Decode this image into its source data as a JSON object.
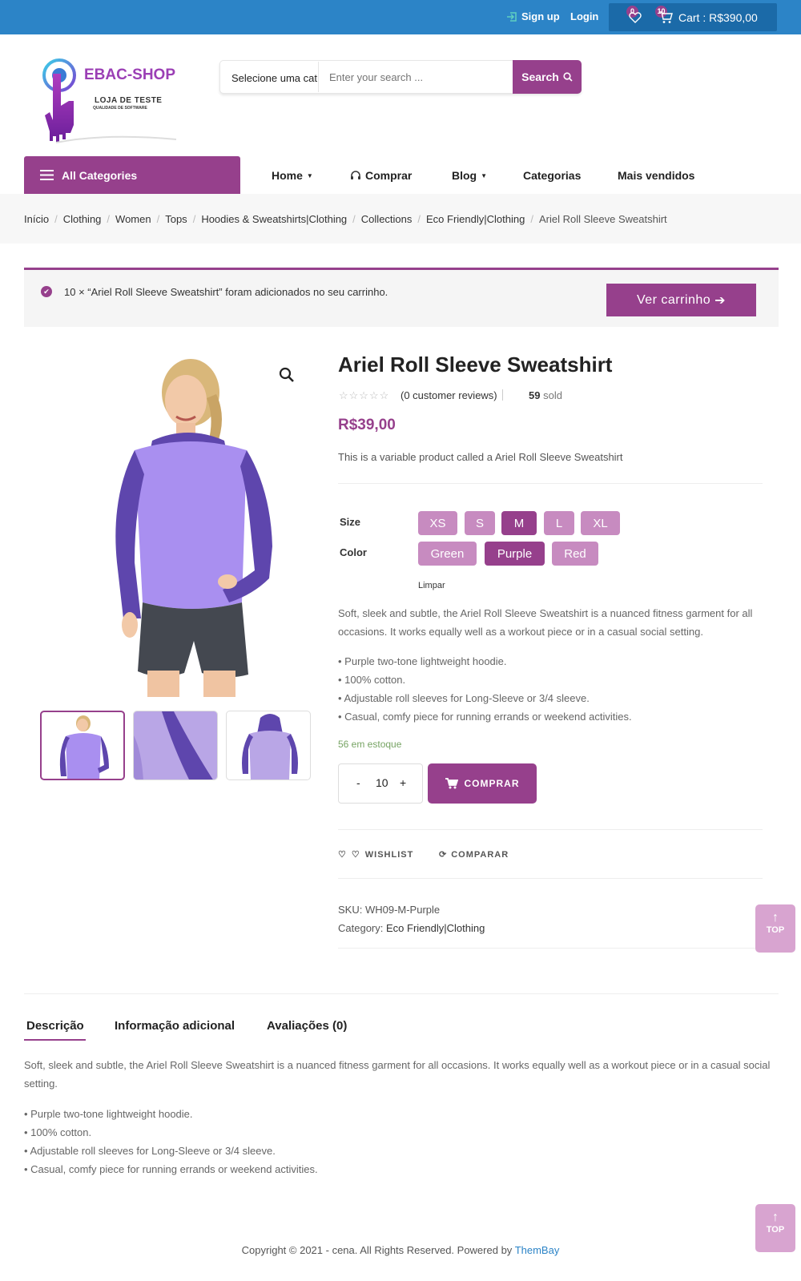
{
  "topbar": {
    "signup": "Sign up",
    "login": "Login",
    "wishlist_count": "0",
    "cart_count": "10",
    "cart_label": "Cart : R$390,00"
  },
  "logo": {
    "brand": "EBAC-SHOP",
    "line1": "LOJA DE TESTE",
    "line2": "QUALIDADE DE SOFTWARE"
  },
  "search": {
    "category": "Selecione uma cat",
    "placeholder": "Enter your search ...",
    "button": "Search"
  },
  "nav": {
    "all_categories": "All Categories",
    "items": [
      "Home",
      "Comprar",
      "Blog",
      "Categorias",
      "Mais vendidos"
    ]
  },
  "breadcrumb": [
    "Início",
    "Clothing",
    "Women",
    "Tops",
    "Hoodies & Sweatshirts|Clothing",
    "Collections",
    "Eco Friendly|Clothing",
    "Ariel Roll Sleeve Sweatshirt"
  ],
  "notice": {
    "message": "10 × “Ariel Roll Sleeve Sweatshirt” foram adicionados no seu carrinho.",
    "button": "Ver carrinho"
  },
  "product": {
    "title": "Ariel Roll Sleeve Sweatshirt",
    "rating": 0,
    "reviews": "(0 customer reviews)",
    "sold_count": "59",
    "sold_label": "sold",
    "price": "R$39,00",
    "short_desc": "This is a variable product called a Ariel Roll Sleeve Sweatshirt",
    "size_label": "Size",
    "sizes": [
      "XS",
      "S",
      "M",
      "L",
      "XL"
    ],
    "selected_size": "M",
    "color_label": "Color",
    "colors": [
      "Green",
      "Purple",
      "Red"
    ],
    "selected_color": "Purple",
    "clear": "Limpar",
    "desc_para": "Soft, sleek and subtle, the Ariel Roll Sleeve Sweatshirt is a nuanced fitness garment for all occasions. It works equally well as a workout piece or in a casual social setting.",
    "bullets": [
      "• Purple two-tone lightweight hoodie.",
      "• 100% cotton.",
      "• Adjustable roll sleeves for Long-Sleeve or 3/4 sleeve.",
      "• Casual, comfy piece for running errands or weekend activities."
    ],
    "stock": "56 em estoque",
    "qty_minus": "-",
    "qty": "10",
    "qty_plus": "+",
    "buy": "COMPRAR",
    "wishlist": "WISHLIST",
    "compare": "COMPARAR",
    "sku_label": "SKU: WH09-M-Purple",
    "category_label": "Category:",
    "category": "Eco Friendly|Clothing"
  },
  "back_to_top": "TOP",
  "tabs": [
    "Descrição",
    "Informação adicional",
    "Avaliações (0)"
  ],
  "footer": {
    "text": "Copyright © 2021 - cena. All Rights Reserved. Powered by",
    "link": "ThemBay"
  }
}
